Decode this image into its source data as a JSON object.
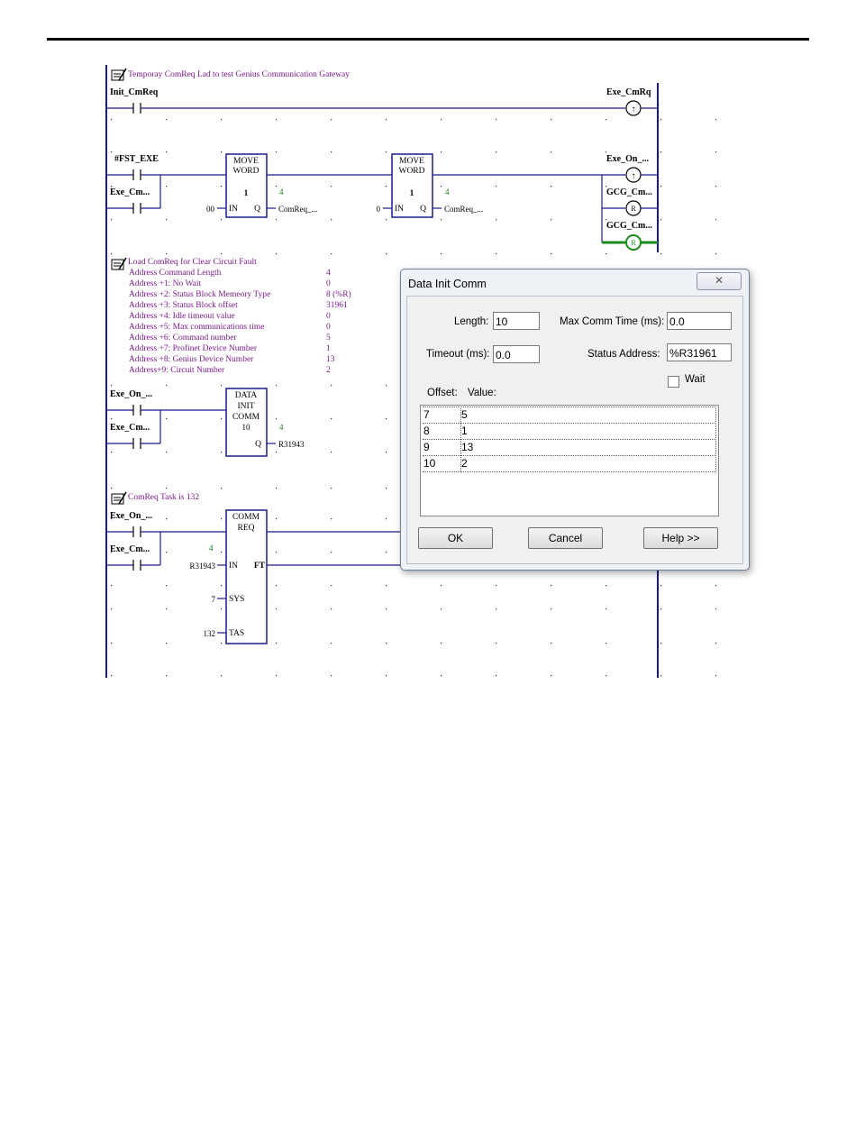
{
  "ladder": {
    "rung1": {
      "comment": "Temporay ComReq Lad to test Genius Communication Gateway",
      "contact": "Init_CmReq",
      "coil": "Exe_CmRq"
    },
    "rung2": {
      "contact1": "#FST_EXE",
      "contact2": "Exe_Cm...",
      "move1": {
        "line1": "MOVE",
        "line2": "WORD",
        "count": "1",
        "out_value": "4",
        "in_value": "00",
        "in_label": "IN",
        "q_label": "Q",
        "dest": "ComReq_..."
      },
      "move2": {
        "line1": "MOVE",
        "line2": "WORD",
        "count": "1",
        "out_value": "4",
        "in_value": "0",
        "in_label": "IN",
        "q_label": "Q",
        "dest": "ComReq_..."
      },
      "coil1": "Exe_On_...",
      "coil2": "GCG_Cm...",
      "coil3": "GCG_Cm..."
    },
    "rung3": {
      "comment_title": "Load ComReq for Clear Circuit Fault",
      "comment_rows": [
        {
          "label": "Address Command Length",
          "value": "4"
        },
        {
          "label": "Address +1: No Wait",
          "value": "0"
        },
        {
          "label": "Address +2: Status Block Memeory Type",
          "value": "8 (%R)"
        },
        {
          "label": "Address +3: Status Block offset",
          "value": "31961"
        },
        {
          "label": "Address +4: Idle timeout value",
          "value": "0"
        },
        {
          "label": "Address +5: Max communications time",
          "value": "0"
        },
        {
          "label": "Address +6: Command number",
          "value": "5"
        },
        {
          "label": "Address +7: Profinet Device Number",
          "value": "1"
        },
        {
          "label": "Address +8: Genius Device Number",
          "value": "13"
        },
        {
          "label": "Address+9: Circuit Number",
          "value": "2"
        }
      ],
      "contact1": "Exe_On_...",
      "contact2": "Exe_Cm...",
      "block": {
        "line1": "DATA",
        "line2": "INIT",
        "line3": "COMM",
        "length": "10",
        "out_value": "4",
        "q_label": "Q",
        "dest": "R31943"
      }
    },
    "rung4": {
      "comment": "ComReq Task is 132",
      "contact1": "Exe_On_...",
      "contact2": "Exe_Cm...",
      "block": {
        "line1": "COMM",
        "line2": "REQ",
        "in_value_top": "4",
        "in_value": "R31943",
        "in_label": "IN",
        "ft_label": "FT",
        "sys_value": "7",
        "sys_label": "SYS",
        "task_value": "132",
        "task_label": "TAS"
      }
    }
  },
  "dialog": {
    "title": "Data Init Comm",
    "close_glyph": "✕",
    "length_label": "Length:",
    "length_value": "10",
    "max_comm_label": "Max Comm Time (ms):",
    "max_comm_value": "0.0",
    "timeout_label": "Timeout (ms):",
    "timeout_value": "0.0",
    "status_label": "Status Address:",
    "status_value": "%R31961",
    "wait_label": "Wait",
    "wait_checked": false,
    "offset_header": "Offset:",
    "value_header": "Value:",
    "rows": [
      {
        "offset": "7",
        "value": "5"
      },
      {
        "offset": "8",
        "value": "1"
      },
      {
        "offset": "9",
        "value": "13"
      },
      {
        "offset": "10",
        "value": "2"
      }
    ],
    "ok_label": "OK",
    "cancel_label": "Cancel",
    "help_label": "Help >>"
  }
}
